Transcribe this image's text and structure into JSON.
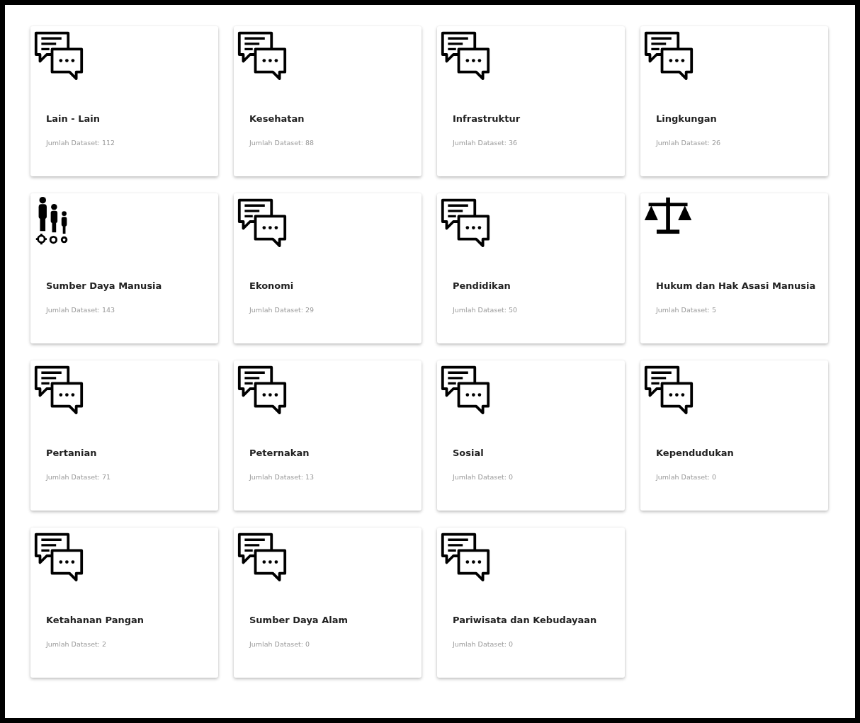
{
  "categories": [
    {
      "kind": "chat",
      "title": "Lain - Lain",
      "count": "Jumlah Dataset: 112"
    },
    {
      "kind": "chat",
      "title": "Kesehatan",
      "count": "Jumlah Dataset: 88"
    },
    {
      "kind": "chat",
      "title": "Infrastruktur",
      "count": "Jumlah Dataset: 36"
    },
    {
      "kind": "chat",
      "title": "Lingkungan",
      "count": "Jumlah Dataset: 26"
    },
    {
      "kind": "people",
      "title": "Sumber Daya Manusia",
      "count": "Jumlah Dataset: 143"
    },
    {
      "kind": "chat",
      "title": "Ekonomi",
      "count": "Jumlah Dataset: 29"
    },
    {
      "kind": "chat",
      "title": "Pendidikan",
      "count": "Jumlah Dataset: 50"
    },
    {
      "kind": "scales",
      "title": "Hukum dan Hak Asasi Manusia",
      "count": "Jumlah Dataset: 5"
    },
    {
      "kind": "chat",
      "title": "Pertanian",
      "count": "Jumlah Dataset: 71"
    },
    {
      "kind": "chat",
      "title": "Peternakan",
      "count": "Jumlah Dataset: 13"
    },
    {
      "kind": "chat",
      "title": "Sosial",
      "count": "Jumlah Dataset: 0"
    },
    {
      "kind": "chat",
      "title": "Kependudukan",
      "count": "Jumlah Dataset: 0"
    },
    {
      "kind": "chat",
      "title": "Ketahanan Pangan",
      "count": "Jumlah Dataset: 2"
    },
    {
      "kind": "chat",
      "title": "Sumber Daya Alam",
      "count": "Jumlah Dataset: 0"
    },
    {
      "kind": "chat",
      "title": "Pariwisata dan Kebudayaan",
      "count": "Jumlah Dataset: 0"
    }
  ]
}
